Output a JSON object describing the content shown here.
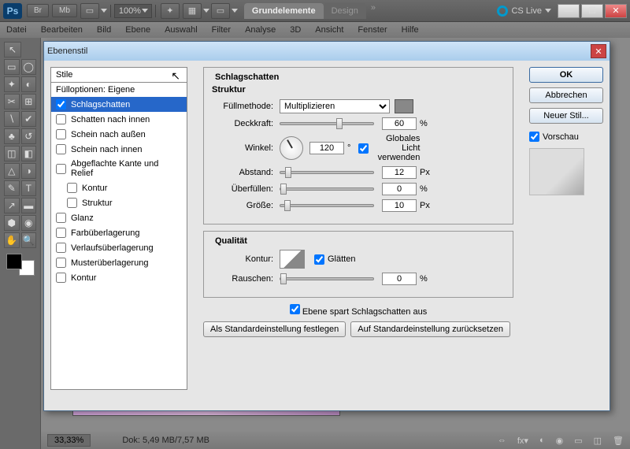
{
  "header": {
    "zoom": "100%",
    "tab_active": "Grundelemente",
    "tab_second": "Design",
    "cslive": "CS Live"
  },
  "menu": {
    "items": [
      "Datei",
      "Bearbeiten",
      "Bild",
      "Ebene",
      "Auswahl",
      "Filter",
      "Analyse",
      "3D",
      "Ansicht",
      "Fenster",
      "Hilfe"
    ]
  },
  "dialog": {
    "title": "Ebenenstil",
    "styles_header": "Stile",
    "blend_options": "Fülloptionen: Eigene",
    "effects": [
      "Schlagschatten",
      "Schatten nach innen",
      "Schein nach außen",
      "Schein nach innen",
      "Abgeflachte Kante und Relief",
      "Kontur",
      "Struktur",
      "Glanz",
      "Farbüberlagerung",
      "Verlaufsüberlagerung",
      "Musterüberlagerung",
      "Kontur"
    ],
    "section_title": "Schlagschatten",
    "struktur_label": "Struktur",
    "fill_label": "Füllmethode:",
    "fill_value": "Multiplizieren",
    "opacity_label": "Deckkraft:",
    "opacity_value": "60",
    "opacity_unit": "%",
    "angle_label": "Winkel:",
    "angle_value": "120",
    "angle_unit": "°",
    "global_light": "Globales Licht verwenden",
    "distance_label": "Abstand:",
    "distance_value": "12",
    "distance_unit": "Px",
    "spread_label": "Überfüllen:",
    "spread_value": "0",
    "spread_unit": "%",
    "size_label": "Größe:",
    "size_value": "10",
    "size_unit": "Px",
    "quality_label": "Qualität",
    "contour_label": "Kontur:",
    "smooth_label": "Glätten",
    "noise_label": "Rauschen:",
    "noise_value": "0",
    "noise_unit": "%",
    "knockout_label": "Ebene spart Schlagschatten aus",
    "btn_default": "Als Standardeinstellung festlegen",
    "btn_reset": "Auf Standardeinstellung zurücksetzen",
    "ok": "OK",
    "cancel": "Abbrechen",
    "newstyle": "Neuer Stil...",
    "preview": "Vorschau"
  },
  "status": {
    "zoom": "33,33%",
    "dok": "Dok: 5,49 MB/7,57 MB"
  }
}
